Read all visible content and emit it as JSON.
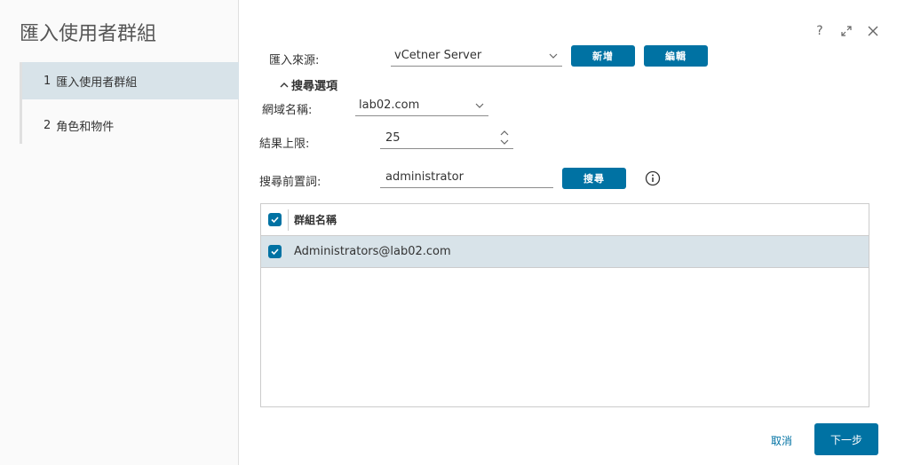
{
  "dialog": {
    "title": "匯入使用者群組"
  },
  "steps": [
    {
      "num": "1",
      "label": "匯入使用者群組",
      "active": true
    },
    {
      "num": "2",
      "label": "角色和物件",
      "active": false
    }
  ],
  "window_controls": {
    "help": "?",
    "expand_icon": "expand-icon",
    "close_icon": "close-icon"
  },
  "source": {
    "label": "匯入來源:",
    "value": "vCetner Server",
    "add_button": "新增",
    "edit_button": "編輯"
  },
  "search_options": {
    "toggle_label": "搜尋選項",
    "domain_label": "網域名稱:",
    "domain_value": "lab02.com",
    "limit_label": "結果上限:",
    "limit_value": "25",
    "prefix_label": "搜尋前置詞:",
    "prefix_value": "administrator",
    "search_button": "搜尋"
  },
  "grid": {
    "column": "群組名稱",
    "rows": [
      {
        "name": "Administrators@lab02.com",
        "checked": true
      }
    ]
  },
  "footer": {
    "cancel": "取消",
    "next": "下一步"
  },
  "colors": {
    "accent": "#0072a3",
    "selected_row": "#d8e3e9"
  }
}
